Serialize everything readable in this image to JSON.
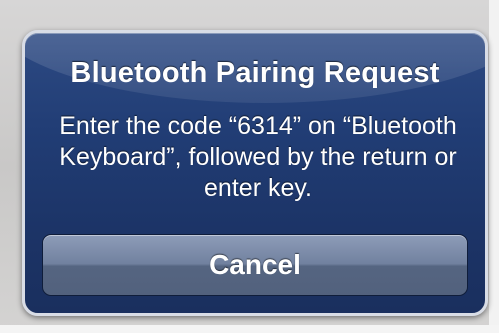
{
  "alert": {
    "title": "Bluetooth Pairing Request",
    "message": "Enter the code “6314” on “Bluetooth Keyboard”, followed by the return or enter key.",
    "cancel_label": "Cancel"
  },
  "colors": {
    "alert_background": "#213d75",
    "alert_border": "#d9dde6",
    "button_background": "#71819f",
    "text": "#ffffff"
  }
}
